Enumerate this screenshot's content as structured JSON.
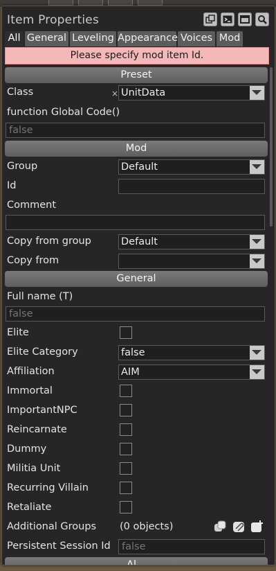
{
  "panel": {
    "title": "Item Properties",
    "title_buttons": [
      "copy-icon",
      "terminal-icon",
      "maximize-icon",
      "search-icon"
    ]
  },
  "tabs": [
    "All",
    "General",
    "Leveling",
    "Appearance",
    "Voices",
    "Mod"
  ],
  "active_tab": "All",
  "warning": "Please specify mod item Id.",
  "sections": {
    "preset": "Preset",
    "mod": "Mod",
    "general": "General",
    "next": "Al..."
  },
  "preset": {
    "class_label": "Class",
    "class_clear": "×",
    "class_value": "UnitData",
    "global_code_label": "function Global Code()",
    "global_code_placeholder": "false"
  },
  "mod": {
    "group_label": "Group",
    "group_value": "Default",
    "id_label": "Id",
    "id_value": "",
    "comment_label": "Comment",
    "comment_value": "",
    "copy_from_group_label": "Copy from group",
    "copy_from_group_value": "Default",
    "copy_from_label": "Copy from",
    "copy_from_value": ""
  },
  "general": {
    "full_name_label": "Full name (T)",
    "full_name_placeholder": "false",
    "elite_label": "Elite",
    "elite_category_label": "Elite Category",
    "elite_category_value": "false",
    "affiliation_label": "Affiliation",
    "affiliation_value": "AIM",
    "immortal_label": "Immortal",
    "important_npc_label": "ImportantNPC",
    "reincarnate_label": "Reincarnate",
    "dummy_label": "Dummy",
    "militia_unit_label": "Militia Unit",
    "recurring_villain_label": "Recurring Villain",
    "retaliate_label": "Retaliate",
    "additional_groups_label": "Additional Groups",
    "additional_groups_value": "(0 objects)",
    "persistent_session_id_label": "Persistent Session Id",
    "persistent_session_id_placeholder": "false"
  },
  "colors": {
    "warning_bg": "#f4b8b8",
    "panel_bg": "#262626",
    "header_bg": "#6e6e6e"
  }
}
